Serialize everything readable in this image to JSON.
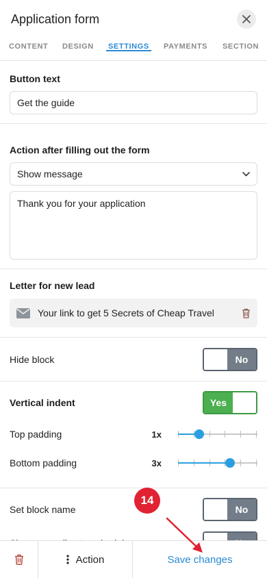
{
  "header": {
    "title": "Application form"
  },
  "tabs": [
    {
      "label": "CONTENT"
    },
    {
      "label": "DESIGN"
    },
    {
      "label": "SETTINGS"
    },
    {
      "label": "PAYMENTS"
    },
    {
      "label": "SECTION"
    }
  ],
  "button_text": {
    "label": "Button text",
    "value": "Get the guide"
  },
  "action_after": {
    "label": "Action after filling out the form",
    "selected": "Show message",
    "message": "Thank you for your application"
  },
  "letter": {
    "label": "Letter for new lead",
    "item": "Your link to get 5 Secrets of Cheap Travel"
  },
  "hide_block": {
    "label": "Hide block",
    "state": "No"
  },
  "vertical_indent": {
    "label": "Vertical indent",
    "state": "Yes",
    "top_padding": {
      "label": "Top padding",
      "value": "1x",
      "level": 1
    },
    "bottom_padding": {
      "label": "Bottom padding",
      "value": "3x",
      "level": 3
    }
  },
  "block_name": {
    "label": "Set block name",
    "state": "No"
  },
  "schedule": {
    "label": "Show according to schedule",
    "state": "No"
  },
  "footer": {
    "action_label": "Action",
    "save_label": "Save changes"
  },
  "annotation": {
    "step": "14"
  },
  "colors": {
    "accent": "#2a8ad4",
    "toggle_on": "#4caf50",
    "toggle_off": "#727d89",
    "badge": "#e02232"
  }
}
